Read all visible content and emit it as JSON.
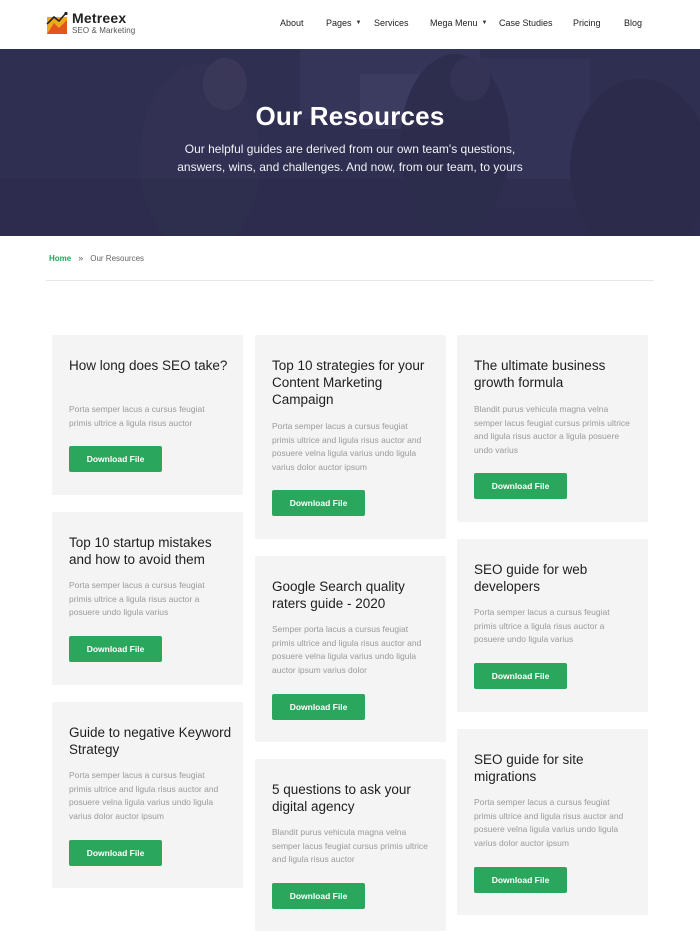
{
  "header": {
    "brand_name": "Metreex",
    "brand_tagline": "SEO & Marketing",
    "nav": [
      {
        "label": "About",
        "dropdown": false
      },
      {
        "label": "Pages",
        "dropdown": true
      },
      {
        "label": "Services",
        "dropdown": false
      },
      {
        "label": "Mega Menu",
        "dropdown": true
      },
      {
        "label": "Case Studies",
        "dropdown": false
      },
      {
        "label": "Pricing",
        "dropdown": false
      },
      {
        "label": "Blog",
        "dropdown": false
      }
    ]
  },
  "hero": {
    "title": "Our Resources",
    "subtitle": "Our helpful guides are derived from our own team's questions, answers, wins, and challenges. And now, from our team, to yours"
  },
  "breadcrumb": {
    "home": "Home",
    "separator": "»",
    "current": "Our Resources"
  },
  "resources": [
    {
      "title": "How long does SEO take?",
      "desc": "Porta semper lacus a cursus feugiat primis ultrice a ligula risus auctor",
      "button": "Download File"
    },
    {
      "title": "Top 10 startup mistakes and how to avoid them",
      "desc": "Porta semper lacus a cursus feugiat primis ultrice a ligula risus auctor a posuere undo ligula varius",
      "button": "Download File"
    },
    {
      "title": "Guide to negative Keyword Strategy",
      "desc": "Porta semper lacus a cursus feugiat primis ultrice and ligula risus auctor and posuere velna ligula varius undo ligula varius dolor auctor ipsum",
      "button": "Download File"
    },
    {
      "title": "Top 10 strategies for your Content Marketing Campaign",
      "desc": "Porta semper lacus a cursus feugiat primis ultrice and ligula risus auctor and posuere velna ligula varius undo ligula varius dolor auctor ipsum",
      "button": "Download File"
    },
    {
      "title": "Google Search quality raters guide - 2020",
      "desc": "Semper porta lacus a cursus feugiat primis ultrice and ligula risus auctor and posuere velna ligula varius undo ligula auctor ipsum varius dolor",
      "button": "Download File"
    },
    {
      "title": "5 questions to ask your digital agency",
      "desc": "Blandit purus vehicula magna velna semper lacus feugiat cursus primis ultrice and ligula risus auctor",
      "button": "Download File"
    },
    {
      "title": "The ultimate business growth formula",
      "desc": "Blandit purus vehicula magna velna semper lacus feugiat cursus primis ultrice and ligula risus auctor a ligula posuere undo varius",
      "button": "Download File"
    },
    {
      "title": "SEO guide for web developers",
      "desc": "Porta semper lacus a cursus feugiat primis ultrice a ligula risus auctor a posuere undo ligula varius",
      "button": "Download File"
    },
    {
      "title": "SEO guide for site migrations",
      "desc": "Porta semper lacus a cursus feugiat primis ultrice and ligula risus auctor and posuere velna ligula varius undo ligula varius dolor auctor ipsum",
      "button": "Download File"
    }
  ],
  "colors": {
    "accent": "#2aa75c",
    "hero_overlay": "#34334f",
    "card_background": "#f4f4f4"
  }
}
